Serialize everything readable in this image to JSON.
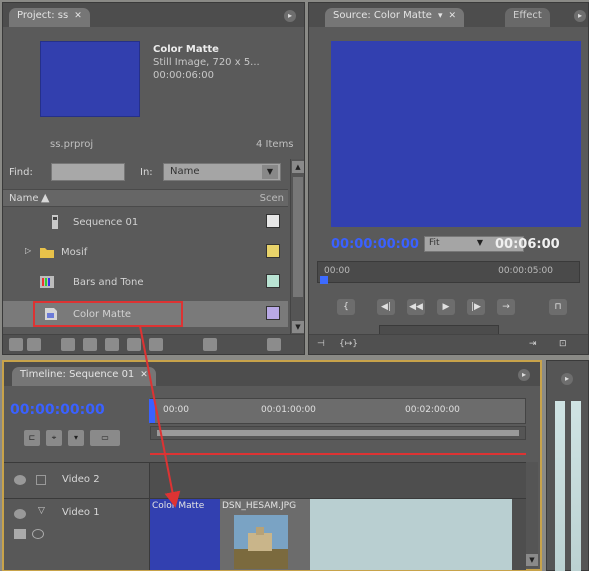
{
  "project": {
    "tab_label": "Project: ss",
    "clip_title": "Color Matte",
    "clip_type": "Still Image, 720 x 5...",
    "clip_duration": "00:00:06:00",
    "project_name": "ss.prproj",
    "item_count": "4 Items",
    "find_label": "Find:",
    "find_value": "",
    "in_label": "In:",
    "in_value": "Name",
    "col_name": "Name",
    "col_scene": "Scen",
    "items": [
      {
        "label": "Sequence 01",
        "swatch": "#e7e7e7"
      },
      {
        "label": "Mosif",
        "swatch": "#e8d36a"
      },
      {
        "label": "Bars and Tone",
        "swatch": "#b9e3d3"
      },
      {
        "label": "Color Matte",
        "swatch": "#b9a9e6"
      }
    ]
  },
  "source": {
    "tab_label": "Source: Color Matte",
    "effects_tab": "Effect",
    "timecode_left": "00:00:00:00",
    "fit_value": "Fit",
    "timecode_right": "00:06:00",
    "ruler_start": "00:00",
    "ruler_end": "00:00:05:00"
  },
  "timeline": {
    "tab_label": "Timeline: Sequence 01",
    "timecode": "00:00:00:00",
    "ruler_labels": [
      "00:00",
      "00:01:00:00",
      "00:02:00:00"
    ],
    "video2_label": "Video 2",
    "video1_label": "Video 1",
    "clip_color_matte": "Color Matte",
    "clip_photo": "DSN_HESAM.JPG"
  },
  "colors": {
    "accent_blue": "#3a61ff",
    "matte_blue": "#3240b0",
    "highlight_red": "#dd3333",
    "timeline_border": "#c8a34a"
  }
}
